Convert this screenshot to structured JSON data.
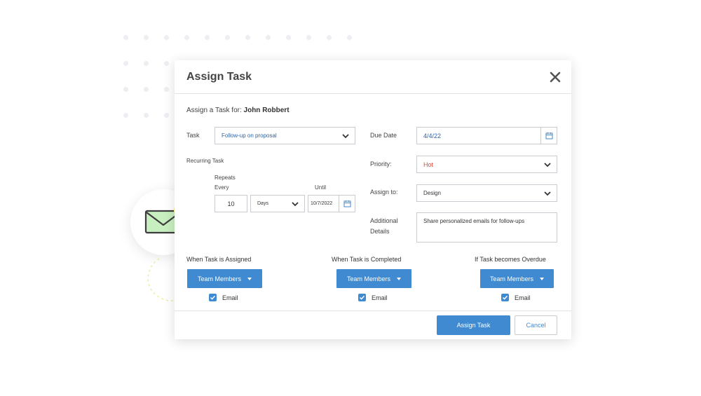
{
  "dialog": {
    "title": "Assign Task",
    "assign_for_label": "Assign a Task for:",
    "assign_for_name": "John Robbert"
  },
  "task": {
    "label": "Task",
    "value": "Follow-up on proposal"
  },
  "recurring": {
    "label": "Recurring Task",
    "repeats_label_1": "Repeats",
    "repeats_label_2": "Every",
    "interval_value": "10",
    "unit_value": "Days",
    "until_label": "Until",
    "until_value": "10/7/2022"
  },
  "due_date": {
    "label": "Due Date",
    "value": "4/4/22"
  },
  "priority": {
    "label": "Priority:",
    "value": "Hot",
    "color": "#e04a3b"
  },
  "assign_to": {
    "label": "Assign to:",
    "value": "Design"
  },
  "details": {
    "label_1": "Additional",
    "label_2": "Details",
    "value": "Share personalized emails for follow-ups"
  },
  "notifications": [
    {
      "title": "When Task is Assigned",
      "button": "Team Members",
      "check": "Email"
    },
    {
      "title": "When Task is Completed",
      "button": "Team Members",
      "check": "Email"
    },
    {
      "title": "If Task becomes Overdue",
      "button": "Team Members",
      "check": "Email"
    }
  ],
  "footer": {
    "primary": "Assign Task",
    "secondary": "Cancel"
  },
  "colors": {
    "accent": "#3f8ad1",
    "envelope": "#c8efc0",
    "bell": "#f7ef92"
  }
}
